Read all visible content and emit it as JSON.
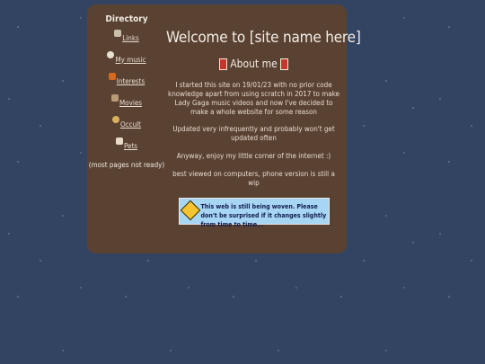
{
  "sidebar": {
    "title": "Directory",
    "items": [
      {
        "label": "Links",
        "icon": "links-icon"
      },
      {
        "label": "My music",
        "icon": "music-icon"
      },
      {
        "label": "Interests",
        "icon": "interests-icon"
      },
      {
        "label": "Movies",
        "icon": "movies-icon"
      },
      {
        "label": "Occult",
        "icon": "occult-icon"
      },
      {
        "label": "Pets",
        "icon": "pets-icon"
      }
    ],
    "note": "(most pages not ready)"
  },
  "main": {
    "title": "Welcome to [site name here]",
    "about_heading": "About me",
    "paragraphs": [
      "I started this site on 19/01/23 with no prior code knowledge apart from using scratch in 2017 to make Lady Gaga music videos and now I've decided to make a whole website for some reason",
      "Updated very infrequently and probably won't get updated often",
      "Anyway, enjoy my little corner of the internet :)",
      "best viewed on computers, phone version is still a wip"
    ],
    "banner_text": "This web is still being woven. Please don't be surprised if it changes slightly from time to time..."
  },
  "colors": {
    "background": "#334462",
    "panel": "#5a4232",
    "banner": "#a7d6f4"
  }
}
